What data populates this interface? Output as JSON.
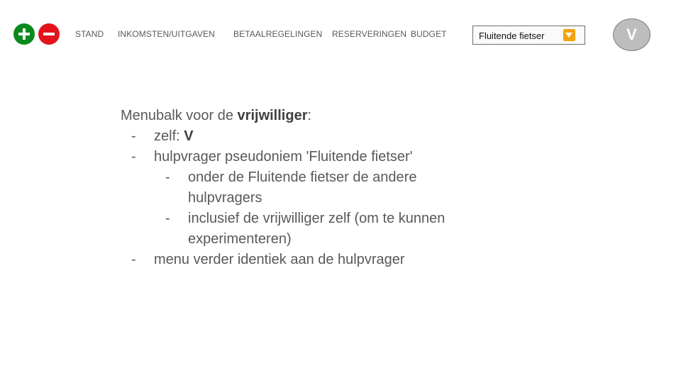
{
  "toolbar": {
    "add_icon": "plus-circle-icon",
    "remove_icon": "minus-circle-icon",
    "add_color": "#0a8a1e",
    "remove_color": "#e3131b"
  },
  "nav": {
    "items": [
      {
        "label": "STAND"
      },
      {
        "label": "INKOMSTEN/UITGAVEN"
      },
      {
        "label": "BETAALREGELINGEN"
      },
      {
        "label": "RESERVERINGEN"
      },
      {
        "label": "BUDGET"
      }
    ]
  },
  "user_select": {
    "selected": "Fluitende fietser",
    "arrow_icon": "chevron-down-icon",
    "arrow_color": "#f4a20f"
  },
  "avatar": {
    "initial": "V",
    "color": "#bdbdbd"
  },
  "notes": {
    "intro_prefix": "Menubalk voor de ",
    "intro_bold": "vrijwilliger",
    "intro_suffix": ":",
    "bullet_marker": "-",
    "b1_prefix": "zelf: ",
    "b1_bold": "V",
    "b2": "hulpvrager pseudoniem 'Fluitende fietser'",
    "b2_sub1_line1": "onder de Fluitende fietser de andere",
    "b2_sub1_line2": "hulpvragers",
    "b2_sub2_line1": "inclusief de vrijwilliger zelf (om te kunnen",
    "b2_sub2_line2": "experimenteren)",
    "b3": "menu verder identiek aan de hulpvrager"
  }
}
